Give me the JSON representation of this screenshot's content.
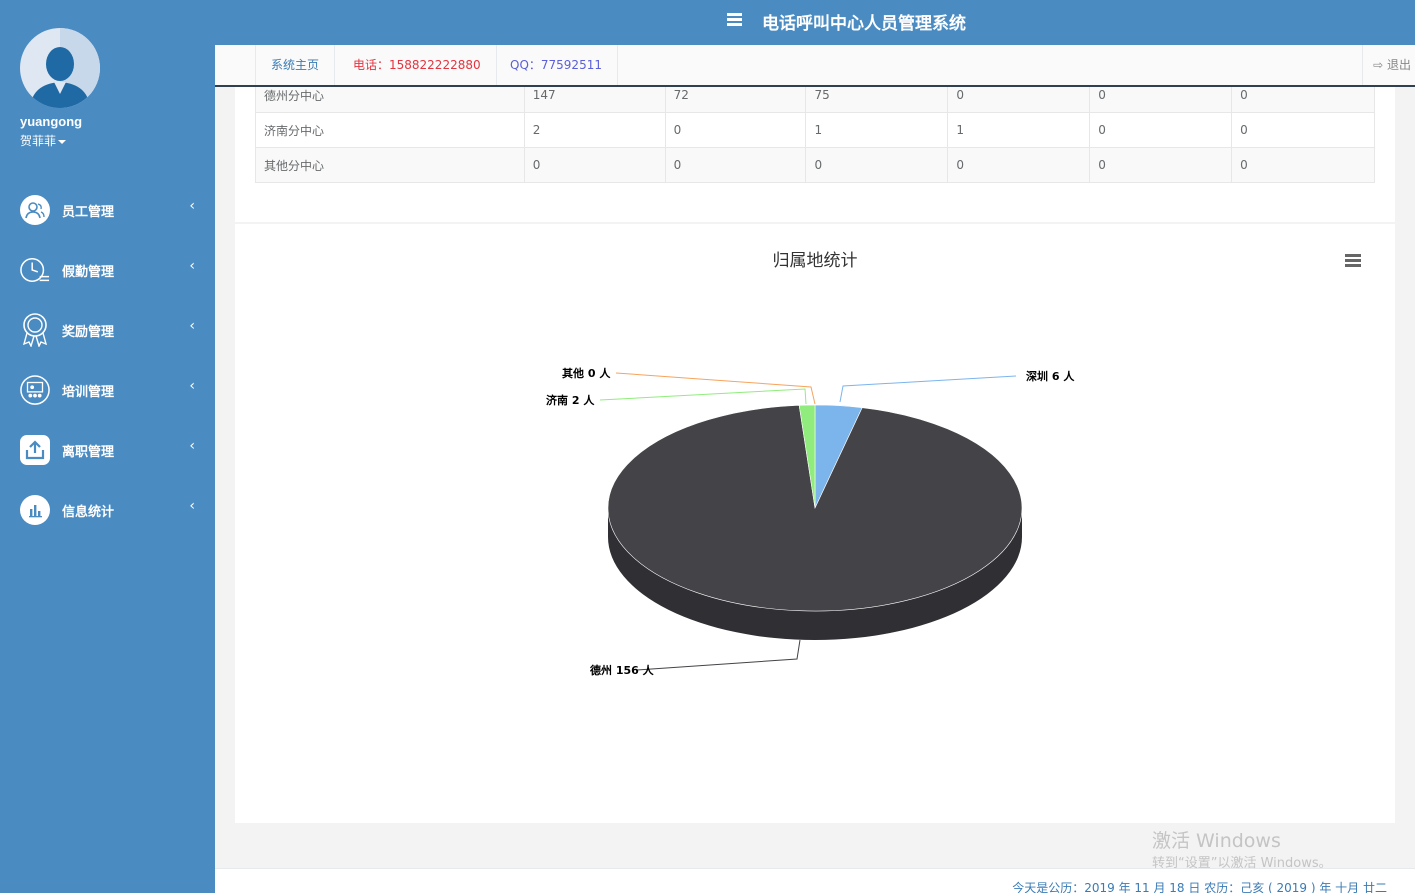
{
  "header": {
    "title": "电话呼叫中心人员管理系统"
  },
  "user": {
    "username": "yuangong",
    "realname": "贺菲菲"
  },
  "sidebar": {
    "items": [
      {
        "label": "员工管理",
        "icon": "staff-icon"
      },
      {
        "label": "假勤管理",
        "icon": "clock-icon"
      },
      {
        "label": "奖励管理",
        "icon": "award-icon"
      },
      {
        "label": "培训管理",
        "icon": "training-icon"
      },
      {
        "label": "离职管理",
        "icon": "upload-icon"
      },
      {
        "label": "信息统计",
        "icon": "bar-chart-icon"
      }
    ]
  },
  "tabs": [
    {
      "label": "系统主页"
    },
    {
      "label": "电话：158822222880"
    },
    {
      "label": "QQ：77592511"
    }
  ],
  "logout_label": "退出",
  "table": {
    "rows": [
      [
        "德州分中心",
        "147",
        "72",
        "75",
        "0",
        "0",
        "0"
      ],
      [
        "济南分中心",
        "2",
        "0",
        "1",
        "1",
        "0",
        "0"
      ],
      [
        "其他分中心",
        "0",
        "0",
        "0",
        "0",
        "0",
        "0"
      ]
    ]
  },
  "chart_data": {
    "type": "pie",
    "title": "归属地统计",
    "three_d": true,
    "slices": [
      {
        "name": "深圳",
        "value": 6,
        "label": "深圳 6 人",
        "color": "#7cb5ec"
      },
      {
        "name": "德州",
        "value": 156,
        "label": "德州 156 人",
        "color": "#434348"
      },
      {
        "name": "济南",
        "value": 2,
        "label": "济南 2 人",
        "color": "#90ed7d"
      },
      {
        "name": "其他",
        "value": 0,
        "label": "其他 0 人",
        "color": "#f7a35c"
      }
    ]
  },
  "footer": {
    "text": "今天是公历：2019 年 11 月 18 日   农历：己亥 ( 2019 ) 年  十月 廿二"
  },
  "watermark": {
    "line1": "激活 Windows",
    "line2": "转到“设置”以激活 Windows。"
  },
  "colors": {
    "sidebar": "#4a8bc2",
    "accent": "#3a7bb5",
    "phone": "#e4343f",
    "qq": "#5b5fd9"
  }
}
